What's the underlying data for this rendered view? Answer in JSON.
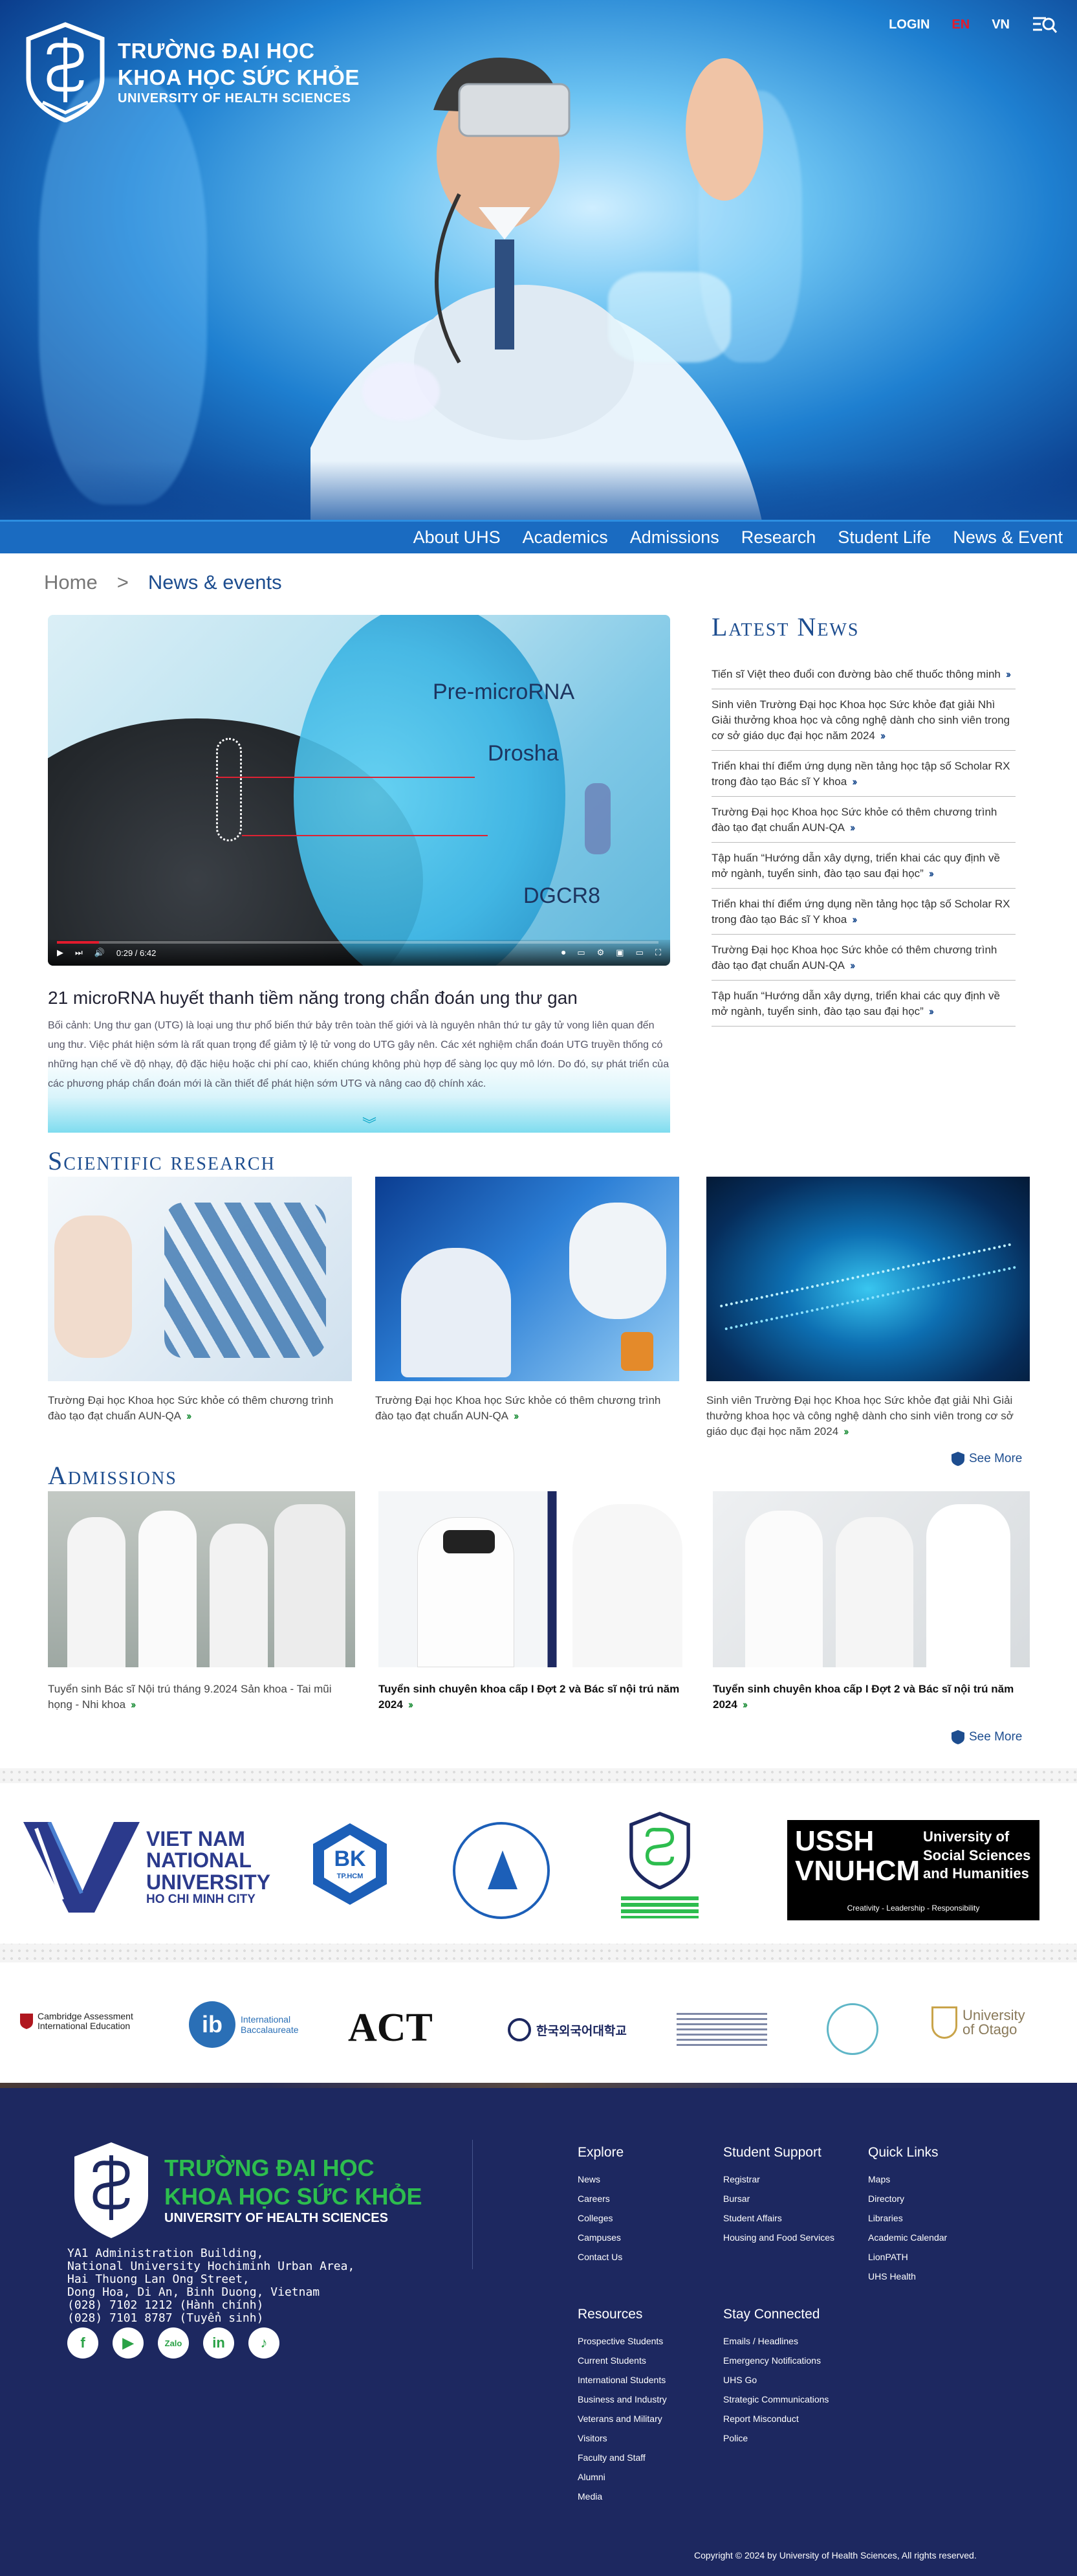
{
  "header": {
    "logo": {
      "line1": "TRƯỜNG ĐẠI HỌC",
      "line2": "KHOA HỌC SỨC KHỎE",
      "line3": "UNIVERSITY OF HEALTH SCIENCES"
    },
    "login": "LOGIN",
    "lang_en": "EN",
    "lang_vn": "VN"
  },
  "nav": {
    "items": [
      "About UHS",
      "Academics",
      "Admissions",
      "Research",
      "Student Life",
      "News & Event"
    ]
  },
  "breadcrumb": {
    "home": "Home",
    "sep": ">",
    "current": "News & events"
  },
  "featured": {
    "video_labels": [
      "Pre-microRNA",
      "Drosha",
      "DGCR8"
    ],
    "time": "0:29 / 6:42",
    "title": "21 microRNA huyết thanh tiềm năng trong chẩn đoán ung thư gan",
    "excerpt": "Bối cảnh: Ung thư gan (UTG) là loại ung thư phổ biến thứ bảy trên toàn thế giới và là nguyên nhân thứ tư gây tử vong liên quan đến ung thư. Việc phát hiện sớm là rất quan trọng để giảm tỷ lệ tử vong do UTG gây nên. Các xét nghiệm chẩn đoán UTG truyền thống có những hạn chế về độ nhạy, độ đặc hiệu hoặc chi phí cao, khiến chúng không phù hợp để sàng lọc quy mô lớn. Do đó, sự phát triển của các phương pháp chẩn đoán mới là cần thiết để phát hiện sớm UTG và nâng cao độ chính xác."
  },
  "latest_news": {
    "title": "Latest News",
    "items": [
      "Tiến sĩ Việt theo đuổi con đường bào chế thuốc thông minh",
      "Sinh viên Trường Đại học Khoa học Sức khỏe đạt giải Nhì Giải thưởng khoa học và công nghệ dành cho sinh viên trong cơ sở giáo dục đại học năm 2024",
      "Triển khai thí điểm ứng dụng nền tảng học tập số Scholar RX trong đào tạo Bác sĩ Y khoa",
      "Trường Đại học Khoa học Sức khỏe có thêm chương trình đào tạo đạt chuẩn AUN-QA",
      "Tập huấn “Hướng dẫn xây dựng, triển khai các quy định về mở ngành, tuyển sinh, đào tạo sau đại học”",
      "Triển khai thí điểm ứng dụng nền tảng học tập số Scholar RX trong đào tạo Bác sĩ Y khoa",
      "Trường Đại học Khoa học Sức khỏe có thêm chương trình đào tạo đạt chuẩn AUN-QA",
      "Tập huấn “Hướng dẫn xây dựng, triển khai các quy định về mở ngành, tuyển sinh, đào tạo sau đại học”"
    ]
  },
  "research": {
    "title": "Scientific research",
    "cards": [
      "Trường Đại học Khoa học Sức khỏe có thêm chương trình đào tạo đạt chuẩn AUN-QA",
      "Trường Đại học Khoa học Sức khỏe có thêm chương trình đào tạo đạt chuẩn AUN-QA",
      "Sinh viên Trường Đại học Khoa học Sức khỏe đạt giải Nhì Giải thưởng khoa học và công nghệ dành cho sinh viên trong cơ sở giáo dục đại học năm 2024"
    ],
    "see_more": "See More"
  },
  "admissions": {
    "title": "Admissions",
    "cards": [
      "Tuyển sinh Bác sĩ Nội trú tháng 9.2024 Sản khoa - Tai mũi họng - Nhi khoa",
      "Tuyển sinh chuyên khoa cấp I Đợt 2 và Bác sĩ nội trú năm 2024",
      "Tuyển sinh chuyên khoa cấp I Đợt 2 và Bác sĩ nội trú năm 2024"
    ],
    "see_more": "See More"
  },
  "partners": {
    "vnu": {
      "l1": "VIET NAM",
      "l2": "NATIONAL",
      "l3": "UNIVERSITY",
      "l4": "HO CHI MINH CITY"
    },
    "bk": "BK",
    "bk_sub": "TP.HCM",
    "ussh": {
      "big1": "USSH",
      "big2": "VNUHCM",
      "small1": "University of",
      "small2": "Social Sciences",
      "small3": "and Humanities",
      "tag": "Creativity - Leadership - Responsibility"
    }
  },
  "intl": {
    "cambridge": "Cambridge Assessment",
    "cambridge2": "International Education",
    "ib": "International Baccalaureate",
    "act": "ACT",
    "korea": "한국외국어대학교",
    "otago": "University of Otago"
  },
  "footer": {
    "logo": {
      "a1": "TRƯỜNG ĐẠI HỌC",
      "a2": "KHOA HỌC SỨC KHỎE",
      "b": "UNIVERSITY OF HEALTH SCIENCES"
    },
    "address": [
      "YA1 Administration Building,",
      "National University Hochiminh Urban Area,",
      "Hai Thuong Lan Ong Street,",
      "Dong Hoa, Di An, Binh Duong, Vietnam",
      "(028) 7102 1212 (Hành chính)",
      "(028) 7101 8787 (Tuyển sinh)"
    ],
    "explore": {
      "title": "Explore",
      "items": [
        "News",
        "Careers",
        "Colleges",
        "Campuses",
        "Contact Us"
      ]
    },
    "support": {
      "title": "Student Support",
      "items": [
        "Registrar",
        "Bursar",
        "Student Affairs",
        "Housing and Food Services"
      ]
    },
    "quick": {
      "title": "Quick Links",
      "items": [
        "Maps",
        "Directory",
        "Libraries",
        "Academic Calendar",
        "LionPATH",
        "UHS Health"
      ]
    },
    "resources": {
      "title": "Resources",
      "items": [
        "Prospective Students",
        "Current Students",
        "International Students",
        "Business and Industry",
        "Veterans and Military",
        "Visitors",
        "Faculty and Staff",
        "Alumni",
        "Media"
      ]
    },
    "connected": {
      "title": "Stay Connected",
      "items": [
        "Emails / Headlines",
        "Emergency Notifications",
        "UHS Go",
        "Strategic Communications",
        "Report Misconduct",
        "Police"
      ]
    },
    "copyright": "Copyright © 2024 by University of Health Sciences, All rights reserved."
  },
  "colors": {
    "nav": "#1a6bc1",
    "footer": "#1d2860",
    "accent_green": "#2dbd4e",
    "title_blue": "#1d4d8f"
  }
}
